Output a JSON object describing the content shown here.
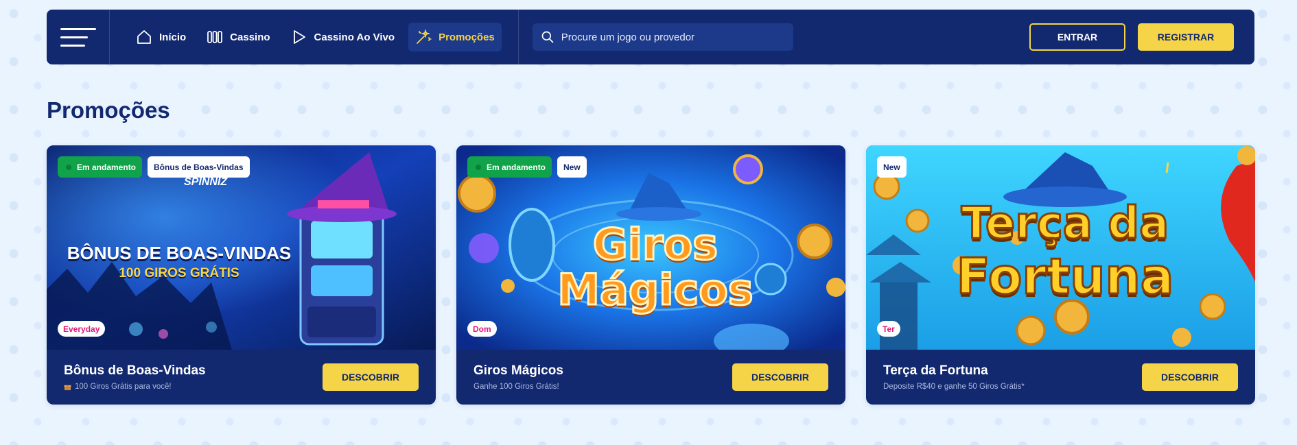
{
  "nav": {
    "items": [
      {
        "label": "Início",
        "icon": "home-icon"
      },
      {
        "label": "Cassino",
        "icon": "slots-icon"
      },
      {
        "label": "Cassino Ao Vivo",
        "icon": "play-icon"
      },
      {
        "label": "Promoções",
        "icon": "magic-wand-icon",
        "active": true
      }
    ],
    "search_placeholder": "Procure um jogo ou provedor",
    "login_label": "ENTRAR",
    "register_label": "REGISTRAR"
  },
  "page_title": "Promoções",
  "cards": [
    {
      "badges": [
        "Em andamento",
        "Bônus de Boas-Vindas"
      ],
      "day": "Everyday",
      "image_heading_1": "BÔNUS DE BOAS-VINDAS",
      "image_heading_2": "100 GIROS GRÁTIS",
      "image_logo": "SPINNIZ",
      "title": "Bônus de Boas-Vindas",
      "subtitle": "100 Giros Grátis para você!",
      "button": "DESCOBRIR"
    },
    {
      "badges": [
        "Em andamento",
        "New"
      ],
      "day": "Dom",
      "image_heading_1": "Giros",
      "image_heading_2": "Mágicos",
      "title": "Giros Mágicos",
      "subtitle": "Ganhe 100 Giros Grátis!",
      "button": "DESCOBRIR"
    },
    {
      "badges": [
        "New"
      ],
      "day": "Ter",
      "image_heading_1": "Terça da",
      "image_heading_2": "Fortuna",
      "title": "Terça da Fortuna",
      "subtitle": "Deposite R$40 e ganhe 50 Giros Grátis*",
      "button": "DESCOBRIR"
    }
  ],
  "colors": {
    "navy": "#13296f",
    "yellow": "#f5d547",
    "green": "#10a34a",
    "pink": "#e0177b"
  }
}
